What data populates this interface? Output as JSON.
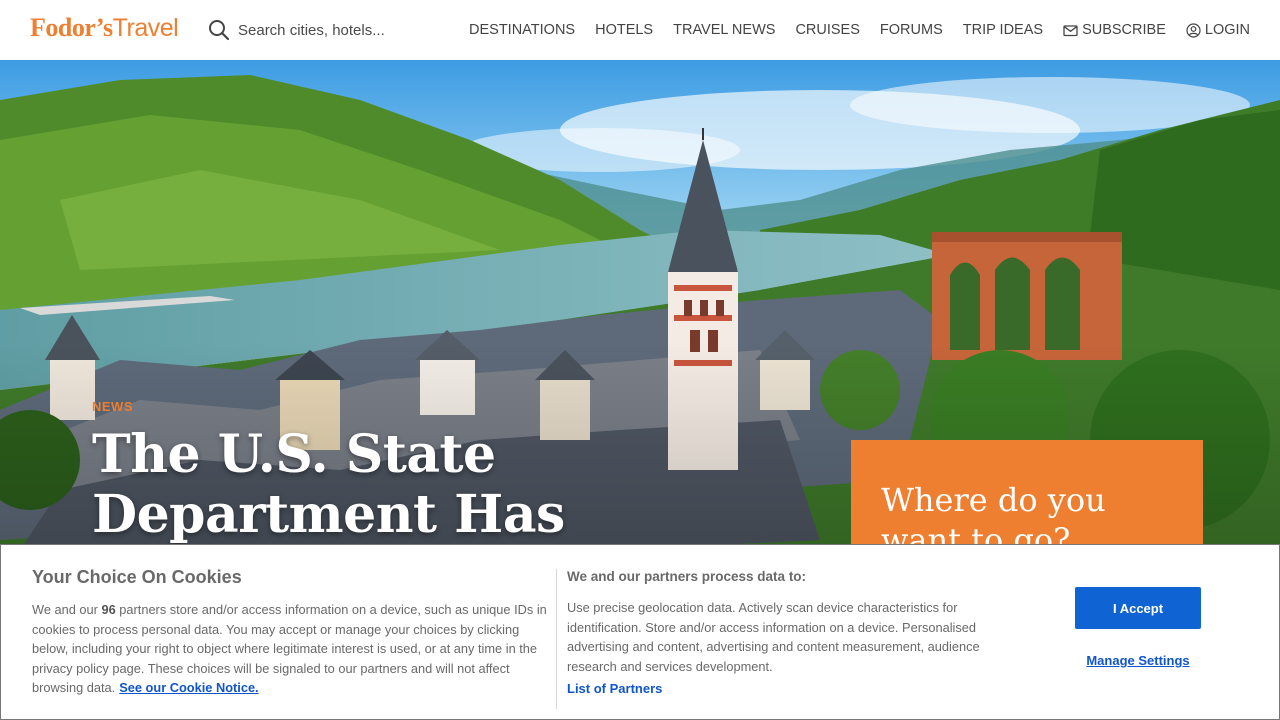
{
  "header": {
    "logo": {
      "part1": "Fodor’s",
      "part2": "Travel"
    },
    "search": {
      "placeholder": "Search cities, hotels..."
    },
    "nav": [
      {
        "label": "DESTINATIONS"
      },
      {
        "label": "HOTELS"
      },
      {
        "label": "TRAVEL NEWS"
      },
      {
        "label": "CRUISES"
      },
      {
        "label": "FORUMS"
      },
      {
        "label": "TRIP IDEAS"
      },
      {
        "label": "SUBSCRIBE",
        "icon": "envelope-icon"
      },
      {
        "label": "LOGIN",
        "icon": "user-circle-icon"
      }
    ]
  },
  "hero": {
    "tag": "NEWS",
    "headline": "The U.S. State Department Has Warnings Against These",
    "where_box_title": "Where do you want to go?"
  },
  "cookie_banner": {
    "title": "Your Choice On Cookies",
    "text_before": "We and our ",
    "partner_count": "96",
    "text_after": " partners store and/or access information on a device, such as unique IDs in cookies to process personal data. You may accept or manage your choices by clicking below, including your right to object where legitimate interest is used, or at any time in the privacy policy page. These choices will be signaled to our partners and will not affect browsing data.",
    "notice_link": "See our Cookie Notice.",
    "purposes_title": "We and our partners process data to:",
    "purposes_text": "Use precise geolocation data. Actively scan device characteristics for identification. Store and/or access information on a device. Personalised advertising and content, advertising and content measurement, audience research and services development.",
    "partners_link": "List of Partners",
    "accept_label": "I Accept",
    "manage_label": "Manage Settings"
  },
  "colors": {
    "brand_orange": "#ef7f30",
    "link_blue": "#1155cc",
    "button_blue": "#0f63d3"
  }
}
